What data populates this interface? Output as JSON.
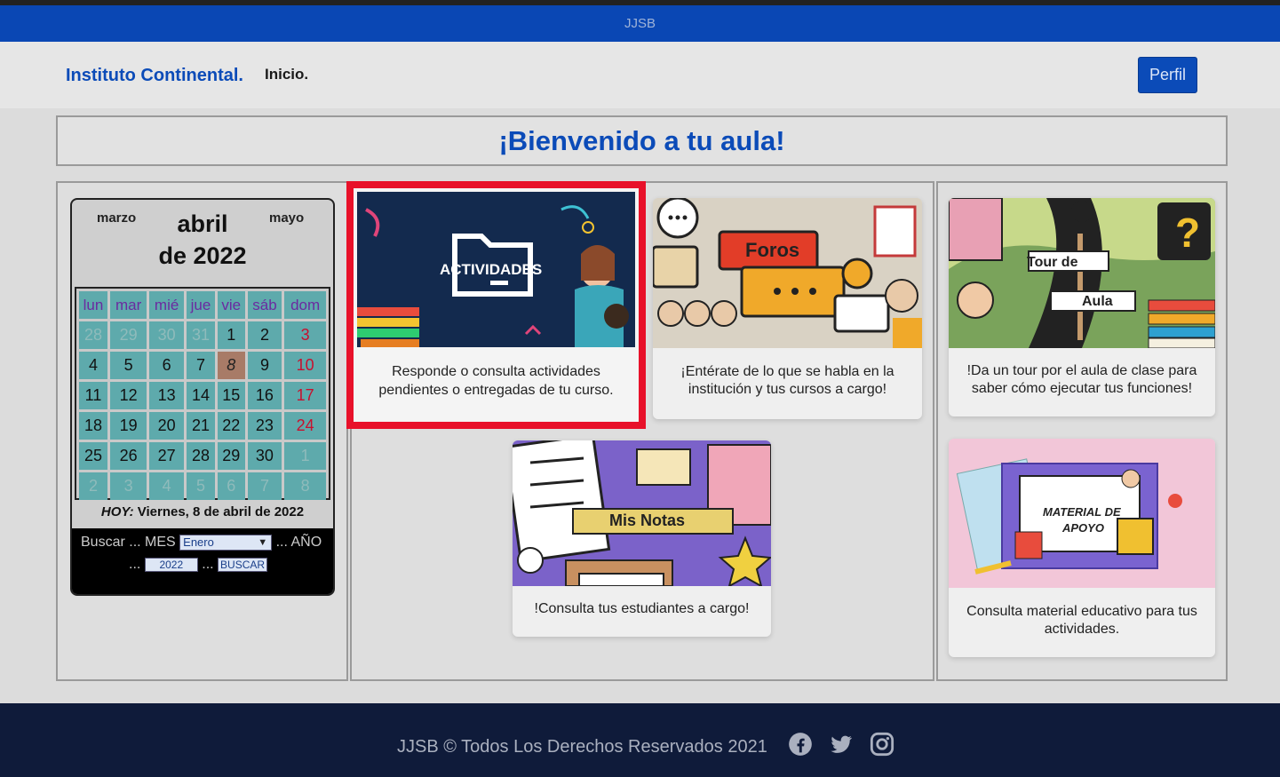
{
  "brandbar": {
    "title": "JJSB"
  },
  "navbar": {
    "brand": "Instituto Continental.",
    "inicio": "Inicio.",
    "perfil": "Perfil"
  },
  "welcome": {
    "title": "¡Bienvenido a tu aula!"
  },
  "calendar": {
    "prev_month": "marzo",
    "next_month": "mayo",
    "month": "abril",
    "year": "de 2022",
    "weekdays": [
      "lun",
      "mar",
      "mié",
      "jue",
      "vie",
      "sáb",
      "dom"
    ],
    "weeks": [
      [
        "28",
        "29",
        "30",
        "31",
        "1",
        "2",
        "3"
      ],
      [
        "4",
        "5",
        "6",
        "7",
        "8",
        "9",
        "10"
      ],
      [
        "11",
        "12",
        "13",
        "14",
        "15",
        "16",
        "17"
      ],
      [
        "18",
        "19",
        "20",
        "21",
        "22",
        "23",
        "24"
      ],
      [
        "25",
        "26",
        "27",
        "28",
        "29",
        "30",
        "1"
      ],
      [
        "2",
        "3",
        "4",
        "5",
        "6",
        "7",
        "8"
      ]
    ],
    "hoy_label": "HOY:",
    "hoy_value": "Viernes, 8 de abril de 2022",
    "search_label": "Buscar ... MES",
    "month_select": "Enero",
    "year_label": "... AÑO",
    "dots": "...",
    "dots2": "...",
    "year_input": "2022",
    "search_button": "BUSCAR"
  },
  "cards": {
    "actividades": {
      "image_text": "ACTIVIDADES",
      "text": "Responde o consulta actividades pendientes o entregadas de tu curso."
    },
    "foros": {
      "image_text": "Foros",
      "text": "¡Entérate de lo que se habla en la institución y tus cursos a cargo!"
    },
    "tour": {
      "image_text_1": "Tour de",
      "image_text_2": "Aula",
      "text": "!Da un tour por el aula de clase para saber cómo ejecutar tus funciones!"
    },
    "notas": {
      "image_text": "Mis Notas",
      "text": "!Consulta tus estudiantes a cargo!"
    },
    "material": {
      "image_text_1": "MATERIAL DE",
      "image_text_2": "APOYO",
      "text": "Consulta material educativo para tus actividades."
    }
  },
  "footer": {
    "text": "JJSB © Todos Los Derechos Reservados 2021",
    "icons": [
      "facebook-icon",
      "twitter-icon",
      "instagram-icon"
    ]
  },
  "colors": {
    "brand_blue": "#0b4bb8",
    "highlight_red": "#e8112a",
    "footer_bg": "#0f1b3a"
  }
}
